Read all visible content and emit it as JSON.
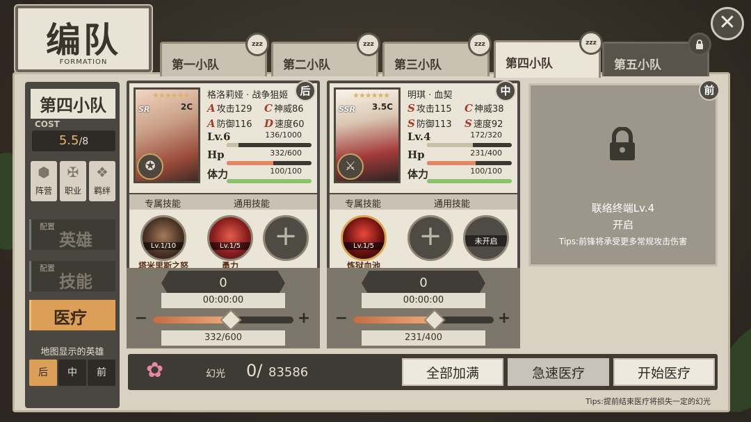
{
  "header": {
    "title_cn": "编队",
    "title_en": "FORMATION",
    "close_glyph": "✕"
  },
  "tabs": [
    {
      "label": "第一小队",
      "badge": "zzz",
      "state": "sleep"
    },
    {
      "label": "第二小队",
      "badge": "zzz",
      "state": "sleep"
    },
    {
      "label": "第三小队",
      "badge": "zzz",
      "state": "sleep"
    },
    {
      "label": "第四小队",
      "badge": "zzz",
      "state": "active"
    },
    {
      "label": "第五小队",
      "badge": "lock",
      "state": "locked"
    }
  ],
  "sidebar": {
    "team_name": "第四小队",
    "cost_label": "COST",
    "cost_value": "5.5",
    "cost_max": "/8",
    "icons": [
      {
        "label": "阵营",
        "icon": "faction-icon"
      },
      {
        "label": "职业",
        "icon": "class-icon"
      },
      {
        "label": "羁绊",
        "icon": "bond-icon"
      }
    ],
    "buttons": [
      {
        "small": "配置",
        "big": "英雄",
        "active": false
      },
      {
        "small": "配置",
        "big": "技能",
        "active": false
      },
      {
        "small": "",
        "big": "医疗",
        "active": true
      }
    ],
    "map_label": "地图显示的英雄",
    "positions": [
      {
        "label": "后",
        "active": true
      },
      {
        "label": "中",
        "active": false
      },
      {
        "label": "前",
        "active": false
      }
    ]
  },
  "heroes": [
    {
      "name": "格洛莉娅 · 战争狙姬",
      "rarity": "SR",
      "cost": "2C",
      "position": "后",
      "stats": [
        {
          "grade": "A",
          "label": "攻击",
          "value": "129"
        },
        {
          "grade": "C",
          "label": "神威",
          "value": "86"
        },
        {
          "grade": "A",
          "label": "防御",
          "value": "116"
        },
        {
          "grade": "D",
          "label": "速度",
          "value": "60"
        }
      ],
      "lv_label": "Lv.6",
      "exp_text": "136/1000",
      "exp_ratio": 0.136,
      "hp_label": "Hp",
      "hp_text": "332/600",
      "hp_ratio": 0.553,
      "stamina_label": "体力",
      "stamina_text": "100/100",
      "stamina_ratio": 1.0,
      "skill_headers": {
        "exclusive": "专属技能",
        "common": "通用技能"
      },
      "skills": [
        {
          "name": "塔米里斯之怒",
          "lv": "Lv.1/10",
          "kind": "dark"
        },
        {
          "name": "勇力",
          "lv": "Lv.1/5",
          "kind": "red"
        },
        {
          "name": "",
          "lv": "",
          "kind": "empty",
          "glyph": "+"
        }
      ],
      "heal": {
        "count": "0",
        "time": "00:00:00",
        "hp_text": "332/600",
        "ratio": 0.553
      }
    },
    {
      "name": "明琪 · 血契",
      "rarity": "SSR",
      "cost": "3.5C",
      "position": "中",
      "stats": [
        {
          "grade": "S",
          "label": "攻击",
          "value": "115"
        },
        {
          "grade": "C",
          "label": "神威",
          "value": "38"
        },
        {
          "grade": "S",
          "label": "防御",
          "value": "113"
        },
        {
          "grade": "S",
          "label": "速度",
          "value": "92"
        }
      ],
      "lv_label": "Lv.4",
      "exp_text": "172/320",
      "exp_ratio": 0.5375,
      "hp_label": "Hp",
      "hp_text": "231/400",
      "hp_ratio": 0.5775,
      "stamina_label": "体力",
      "stamina_text": "100/100",
      "stamina_ratio": 1.0,
      "skill_headers": {
        "exclusive": "专属技能",
        "common": "通用技能"
      },
      "skills": [
        {
          "name": "炼狱血池",
          "lv": "Lv.1/5",
          "kind": "fire"
        },
        {
          "name": "",
          "lv": "",
          "kind": "empty",
          "glyph": "+"
        },
        {
          "name": "",
          "lv": "",
          "kind": "locked",
          "locked_label": "未开启"
        }
      ],
      "heal": {
        "count": "0",
        "time": "00:00:00",
        "hp_text": "231/400",
        "ratio": 0.5775
      }
    }
  ],
  "locked_slot": {
    "position": "前",
    "line1": "联络终端Lv.4",
    "line2": "开启",
    "tip": "Tips:前锋将承受更多常规攻击伤害"
  },
  "bottom": {
    "currency_label": "幻光",
    "current": "0/",
    "total": "83586",
    "buttons": [
      "全部加满",
      "急速医疗",
      "开始医疗"
    ],
    "tip": "Tips:提前结束医疗将损失一定的幻光"
  },
  "colors": {
    "accent": "#dc9f58",
    "hp": "#e08a63",
    "stamina": "#8cc06a",
    "exp": "#c8bfa8"
  }
}
